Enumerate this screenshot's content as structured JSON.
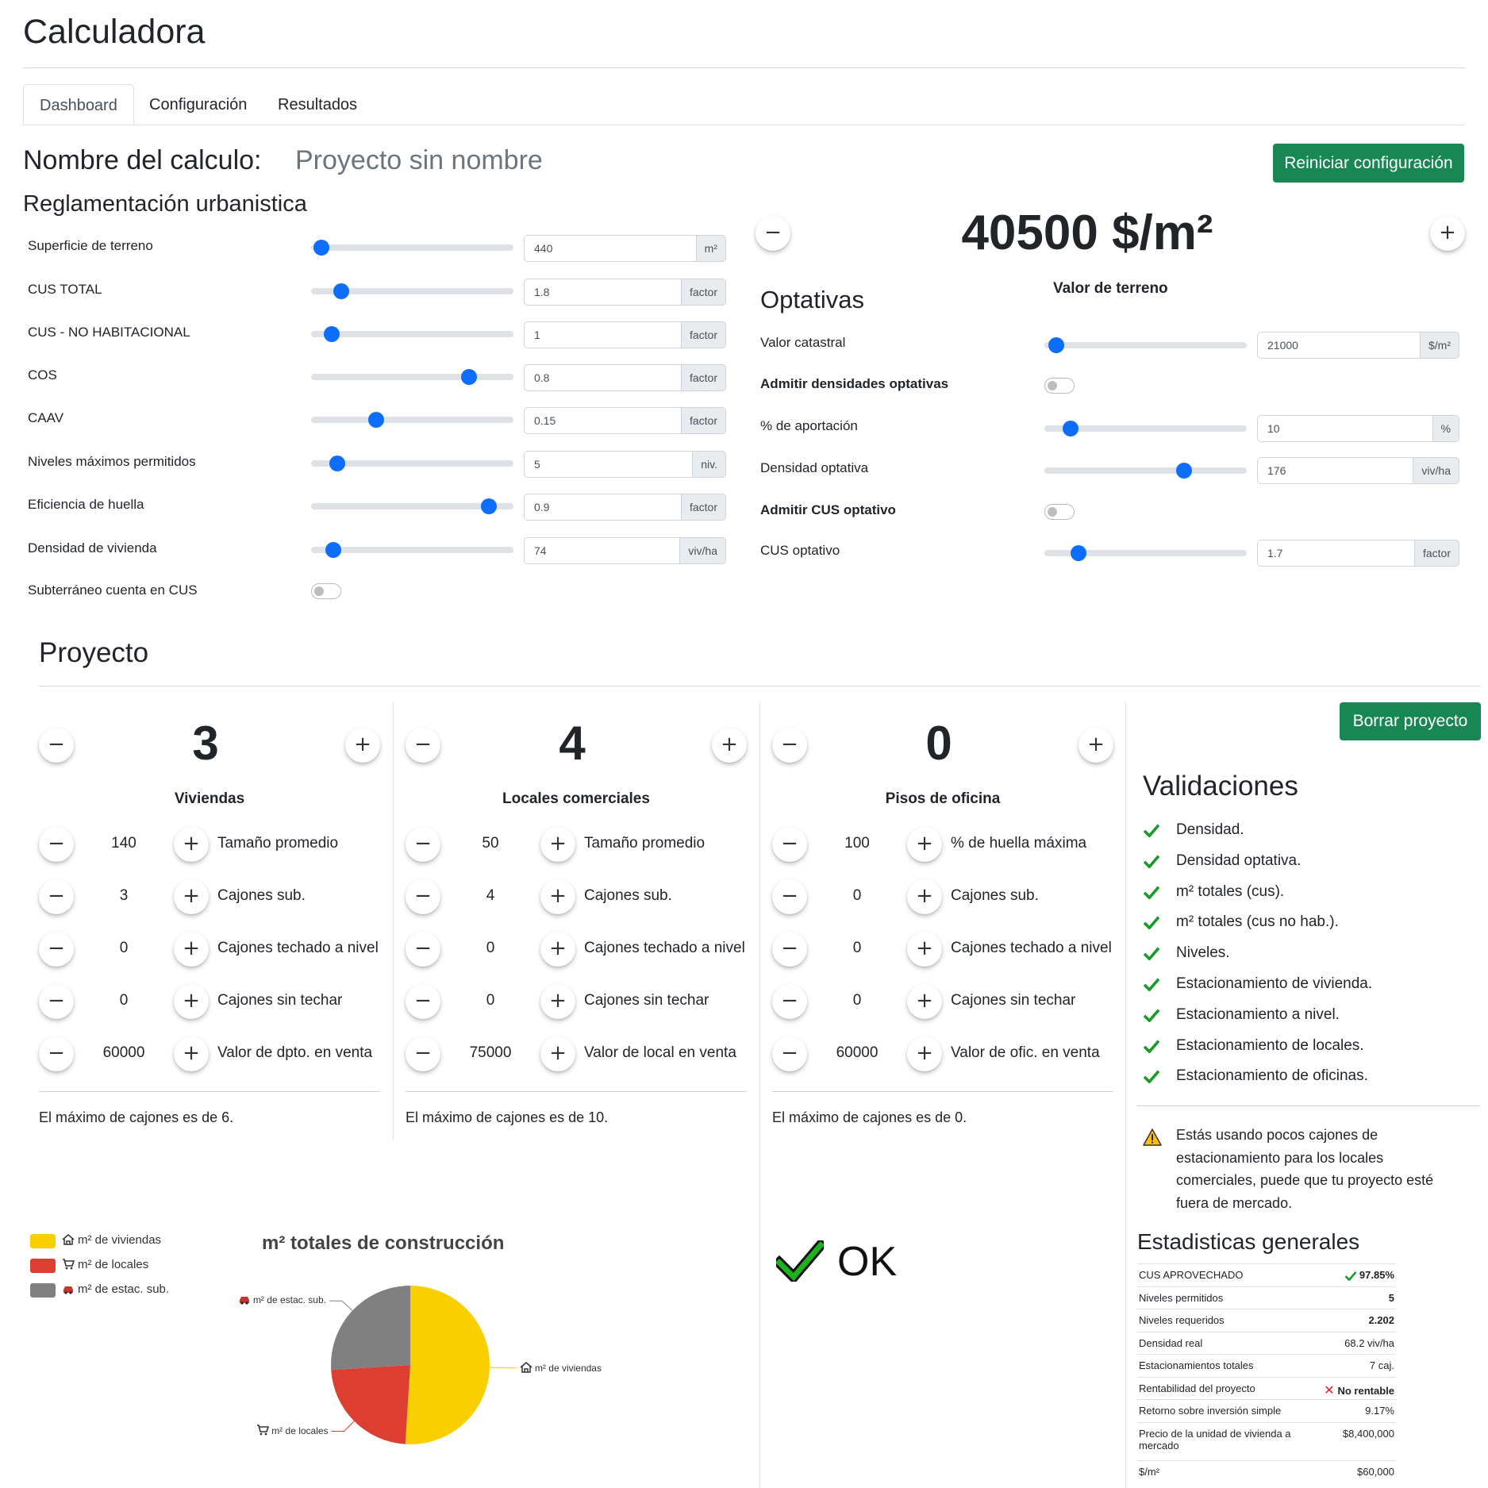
{
  "app": {
    "title": "Calculadora"
  },
  "tabs": [
    {
      "label": "Dashboard",
      "active": true
    },
    {
      "label": "Configuración"
    },
    {
      "label": "Resultados"
    }
  ],
  "calc": {
    "name_label": "Nombre del calculo:",
    "name_value": "Proyecto sin nombre",
    "reset_label": "Reiniciar configuración"
  },
  "reglamentacion": {
    "title": "Reglamentación urbanistica",
    "rows": [
      {
        "label": "Superficie de terreno",
        "value": "440",
        "unit": "m²",
        "fill": 0.05
      },
      {
        "label": "CUS TOTAL",
        "value": "1.8",
        "unit": "factor",
        "fill": 0.15
      },
      {
        "label": "CUS - NO HABITACIONAL",
        "value": "1",
        "unit": "factor",
        "fill": 0.1
      },
      {
        "label": "COS",
        "value": "0.8",
        "unit": "factor",
        "fill": 0.78
      },
      {
        "label": "CAAV",
        "value": "0.15",
        "unit": "factor",
        "fill": 0.32
      },
      {
        "label": "Niveles máximos permitidos",
        "value": "5",
        "unit": "niv.",
        "fill": 0.13
      },
      {
        "label": "Eficiencia de huella",
        "value": "0.9",
        "unit": "factor",
        "fill": 0.88
      },
      {
        "label": "Densidad de vivienda",
        "value": "74",
        "unit": "viv/ha",
        "fill": 0.11
      }
    ],
    "toggle_label": "Subterráneo cuenta en CUS"
  },
  "terreno": {
    "price": "40500 $/m²",
    "label": "Valor de terreno",
    "minus": "−",
    "plus": "+"
  },
  "optativas": {
    "title": "Optativas",
    "valor_catastral": {
      "label": "Valor catastral",
      "value": "21000",
      "unit": "$/m²",
      "fill": 0.06
    },
    "admitir_densidades": "Admitir densidades optativas",
    "aportacion": {
      "label": "% de aportación",
      "value": "10",
      "unit": "%",
      "fill": 0.13
    },
    "densidad_optativa": {
      "label": "Densidad optativa",
      "value": "176",
      "unit": "viv/ha",
      "fill": 0.69
    },
    "admitir_cus": "Admitir CUS optativo",
    "cus_optativo": {
      "label": "CUS optativo",
      "value": "1.7",
      "unit": "factor",
      "fill": 0.17
    }
  },
  "proyecto": {
    "title": "Proyecto",
    "delete_label": "Borrar proyecto",
    "columns": [
      {
        "count": "3",
        "title": "Viviendas",
        "rows": [
          {
            "value": "140",
            "label": "Tamaño promedio"
          },
          {
            "value": "3",
            "label": "Cajones sub."
          },
          {
            "value": "0",
            "label": "Cajones techado a nivel"
          },
          {
            "value": "0",
            "label": "Cajones sin techar"
          },
          {
            "value": "60000",
            "label": "Valor de dpto. en venta"
          }
        ],
        "note": "El máximo de cajones es de 6."
      },
      {
        "count": "4",
        "title": "Locales comerciales",
        "rows": [
          {
            "value": "50",
            "label": "Tamaño promedio"
          },
          {
            "value": "4",
            "label": "Cajones sub."
          },
          {
            "value": "0",
            "label": "Cajones techado a nivel"
          },
          {
            "value": "0",
            "label": "Cajones sin techar"
          },
          {
            "value": "75000",
            "label": "Valor de local en venta"
          }
        ],
        "note": "El máximo de cajones es de 10."
      },
      {
        "count": "0",
        "title": "Pisos de oficina",
        "rows": [
          {
            "value": "100",
            "label": "% de huella máxima"
          },
          {
            "value": "0",
            "label": "Cajones sub."
          },
          {
            "value": "0",
            "label": "Cajones techado a nivel"
          },
          {
            "value": "0",
            "label": "Cajones sin techar"
          },
          {
            "value": "60000",
            "label": "Valor de ofic. en venta"
          }
        ],
        "note": "El máximo de cajones es de 0."
      }
    ]
  },
  "validaciones": {
    "title": "Validaciones",
    "items": [
      "Densidad.",
      "Densidad optativa.",
      "m² totales (cus).",
      "m² totales (cus no hab.).",
      "Niveles.",
      "Estacionamiento de vivienda.",
      "Estacionamiento a nivel.",
      "Estacionamiento de locales.",
      "Estacionamiento de oficinas."
    ],
    "warning_lines": [
      "Estás usando pocos cajones de",
      "estacionamiento para los locales",
      "comerciales, puede que tu proyecto esté",
      "fuera de mercado."
    ]
  },
  "ok_label": "OK",
  "estadisticas": {
    "title": "Estadisticas generales",
    "rows": [
      {
        "k": "CUS APROVECHADO",
        "v": "97.85%",
        "icon": "check",
        "bold": true
      },
      {
        "k": "Niveles permitidos",
        "v": "5",
        "bold": true
      },
      {
        "k": "Niveles requeridos",
        "v": "2.202",
        "bold": true
      },
      {
        "k": "Densidad real",
        "v": "68.2 viv/ha"
      },
      {
        "k": "Estacionamientos totales",
        "v": "7 caj."
      },
      {
        "k": "Rentabilidad del proyecto",
        "v": "No rentable",
        "icon": "cross",
        "bold": true
      },
      {
        "k": "Retorno sobre inversión simple",
        "v": "9.17%"
      },
      {
        "k": "Precio de la unidad de vivienda a",
        "k2": "mercado",
        "v": "$8,400,000"
      },
      {
        "k": "$/m²",
        "v": "$60,000"
      }
    ]
  },
  "chart_data": {
    "type": "pie",
    "title": "m² totales de construcción",
    "legend_position": "left",
    "slices": [
      {
        "name": "m² de viviendas",
        "value": 51,
        "color": "#f9cf00",
        "icon": "house-icon"
      },
      {
        "name": "m² de locales",
        "value": 23,
        "color": "#dc3e32",
        "icon": "cart-icon"
      },
      {
        "name": "m² de estac. sub.",
        "value": 26,
        "color": "#808080",
        "icon": "car-icon"
      }
    ]
  },
  "colors": {
    "primary": "#0d6efd",
    "success": "#198754",
    "check": "#1a9a2a"
  }
}
